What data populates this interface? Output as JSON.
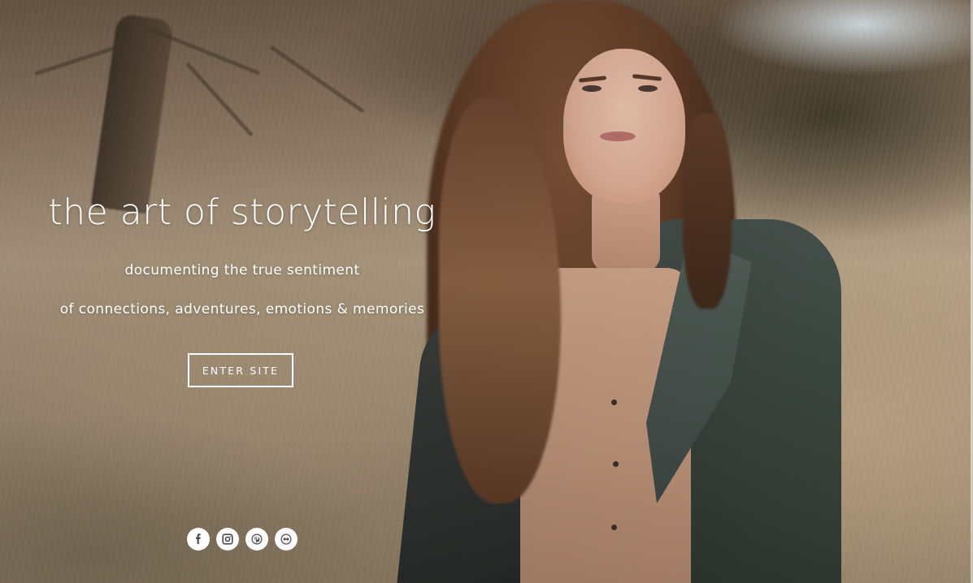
{
  "hero": {
    "title": "the art of storytelling",
    "subtitle_line1": "documenting the true sentiment",
    "subtitle_line2": "of connections, adventures, emotions & memories",
    "cta_label": "ENTER SITE"
  },
  "social": [
    {
      "icon": "facebook-icon"
    },
    {
      "icon": "instagram-icon"
    },
    {
      "icon": "pinterest-icon"
    },
    {
      "icon": "flickr-icon"
    }
  ],
  "colors": {
    "text": "#ffffff",
    "icon_fg": "#4a4a4a"
  }
}
